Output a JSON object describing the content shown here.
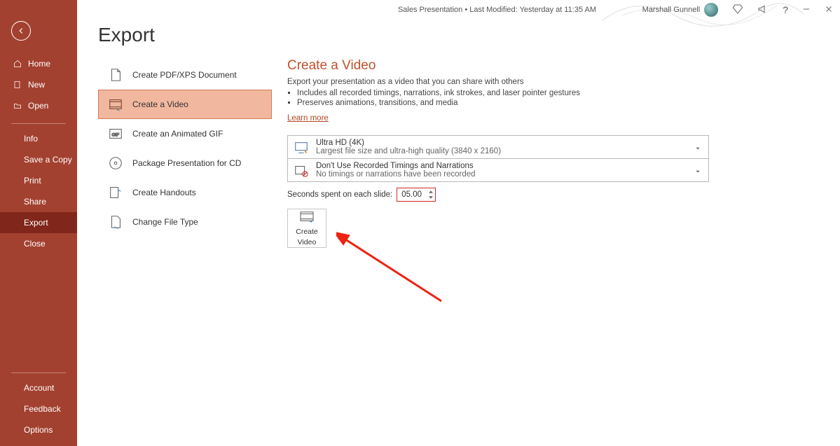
{
  "titlebar": {
    "center": "Sales Presentation • Last Modified: Yesterday at 11:35 AM",
    "user": "Marshall Gunnell",
    "help": "?"
  },
  "sidebar": {
    "home": "Home",
    "new": "New",
    "open": "Open",
    "info": "Info",
    "save_copy": "Save a Copy",
    "print": "Print",
    "share": "Share",
    "export": "Export",
    "close": "Close",
    "account": "Account",
    "feedback": "Feedback",
    "options": "Options"
  },
  "page": {
    "title": "Export"
  },
  "export_items": {
    "pdf": "Create PDF/XPS Document",
    "video": "Create a Video",
    "gif": "Create an Animated GIF",
    "cd": "Package Presentation for CD",
    "handouts": "Create Handouts",
    "filetype": "Change File Type"
  },
  "panel": {
    "title": "Create a Video",
    "desc": "Export your presentation as a video that you can share with others",
    "bullet1": "Includes all recorded timings, narrations, ink strokes, and laser pointer gestures",
    "bullet2": "Preserves animations, transitions, and media",
    "learn": "Learn more",
    "quality_title": "Ultra HD (4K)",
    "quality_sub": "Largest file size and ultra-high quality (3840 x 2160)",
    "timing_title": "Don't Use Recorded Timings and Narrations",
    "timing_sub": "No timings or narrations have been recorded",
    "seconds_label": "Seconds spent on each slide:",
    "seconds_value": "05.00",
    "create_btn_line1": "Create",
    "create_btn_line2": "Video"
  }
}
